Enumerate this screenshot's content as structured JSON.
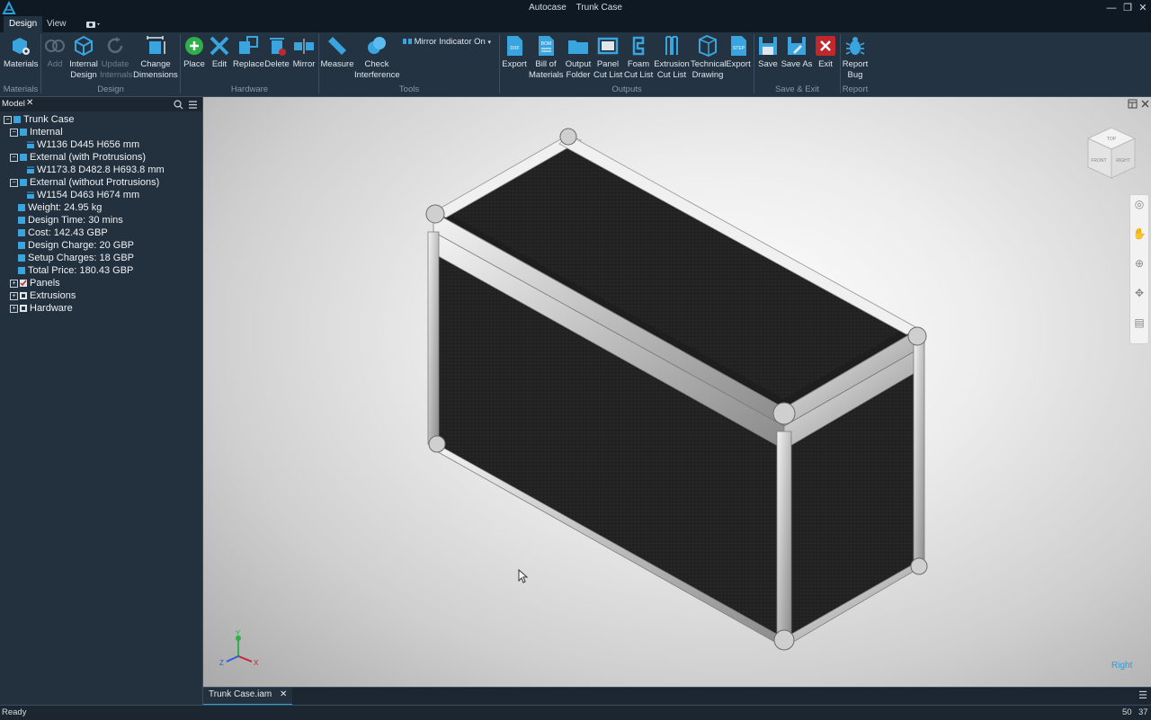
{
  "window": {
    "app_name": "Autocase",
    "doc_name": "Trunk Case",
    "minimize": "—",
    "restore": "❐",
    "close": "✕"
  },
  "menu_tabs": [
    "Design",
    "View"
  ],
  "ribbon": {
    "buttons": {
      "materials": "Materials",
      "add": "Add",
      "internal_design": [
        "Internal",
        "Design"
      ],
      "update_internals": [
        "Update",
        "Internals"
      ],
      "change_dimensions": [
        "Change",
        "Dimensions"
      ],
      "place": "Place",
      "edit": "Edit",
      "replace": "Replace",
      "delete": "Delete",
      "mirror": "Mirror",
      "measure": "Measure",
      "check_interference": [
        "Check",
        "Interference"
      ],
      "mirror_indicator": "Mirror Indicator On",
      "export_dxf": "Export",
      "bill_of_materials": [
        "Bill of",
        "Materials"
      ],
      "output_folder": [
        "Output",
        "Folder"
      ],
      "panel_cut_list": [
        "Panel",
        "Cut List"
      ],
      "foam_cut_list": [
        "Foam",
        "Cut List"
      ],
      "extrusion_cut_list": [
        "Extrusion",
        "Cut List"
      ],
      "technical_drawing": [
        "Technical",
        "Drawing"
      ],
      "export_step": "Export",
      "save": "Save",
      "save_as": "Save As",
      "exit": "Exit",
      "report_bug": [
        "Report",
        "Bug"
      ]
    },
    "badges": {
      "dxf": "DXF",
      "bom": "BOM",
      "step": "STEP"
    },
    "groups": [
      "Materials",
      "Design",
      "Hardware",
      "Tools",
      "Outputs",
      "Save & Exit",
      "Report"
    ]
  },
  "model_panel": {
    "tab": "Model",
    "close": "✕",
    "tree": [
      {
        "label": "Trunk Case",
        "expander": "−"
      },
      {
        "label": "Internal",
        "expander": "−"
      },
      {
        "label": "W1136 D445 H656 mm",
        "expander": ""
      },
      {
        "label": "External (with Protrusions)",
        "expander": "−"
      },
      {
        "label": "W1173.8 D482.8 H693.8 mm",
        "expander": ""
      },
      {
        "label": "External (without Protrusions)",
        "expander": "−"
      },
      {
        "label": "W1154 D463 H674 mm",
        "expander": ""
      },
      {
        "label": "Weight: 24.95 kg",
        "expander": ""
      },
      {
        "label": "Design Time: 30 mins",
        "expander": ""
      },
      {
        "label": "Cost: 142.43 GBP",
        "expander": ""
      },
      {
        "label": "Design Charge: 20 GBP",
        "expander": ""
      },
      {
        "label": "Setup Charges: 18 GBP",
        "expander": ""
      },
      {
        "label": "Total Price: 180.43 GBP",
        "expander": ""
      },
      {
        "label": "Panels",
        "expander": "+"
      },
      {
        "label": "Extrusions",
        "expander": "+"
      },
      {
        "label": "Hardware",
        "expander": "+"
      }
    ]
  },
  "viewport": {
    "viewcube_faces": {
      "top": "TOP",
      "front": "FRONT",
      "right": "RIGHT"
    },
    "view_label": "Right",
    "axis_labels": {
      "x": "X",
      "y": "Y",
      "z": "Z"
    }
  },
  "doc_tab": {
    "label": "Trunk Case.iam",
    "close": "✕"
  },
  "status": {
    "text": "Ready",
    "n1": "50",
    "n2": "37"
  },
  "colors": {
    "accent": "#2a9fd8",
    "ribbon_bg": "#243342",
    "panel_bg": "#23303d",
    "exit_red": "#c0282d"
  }
}
